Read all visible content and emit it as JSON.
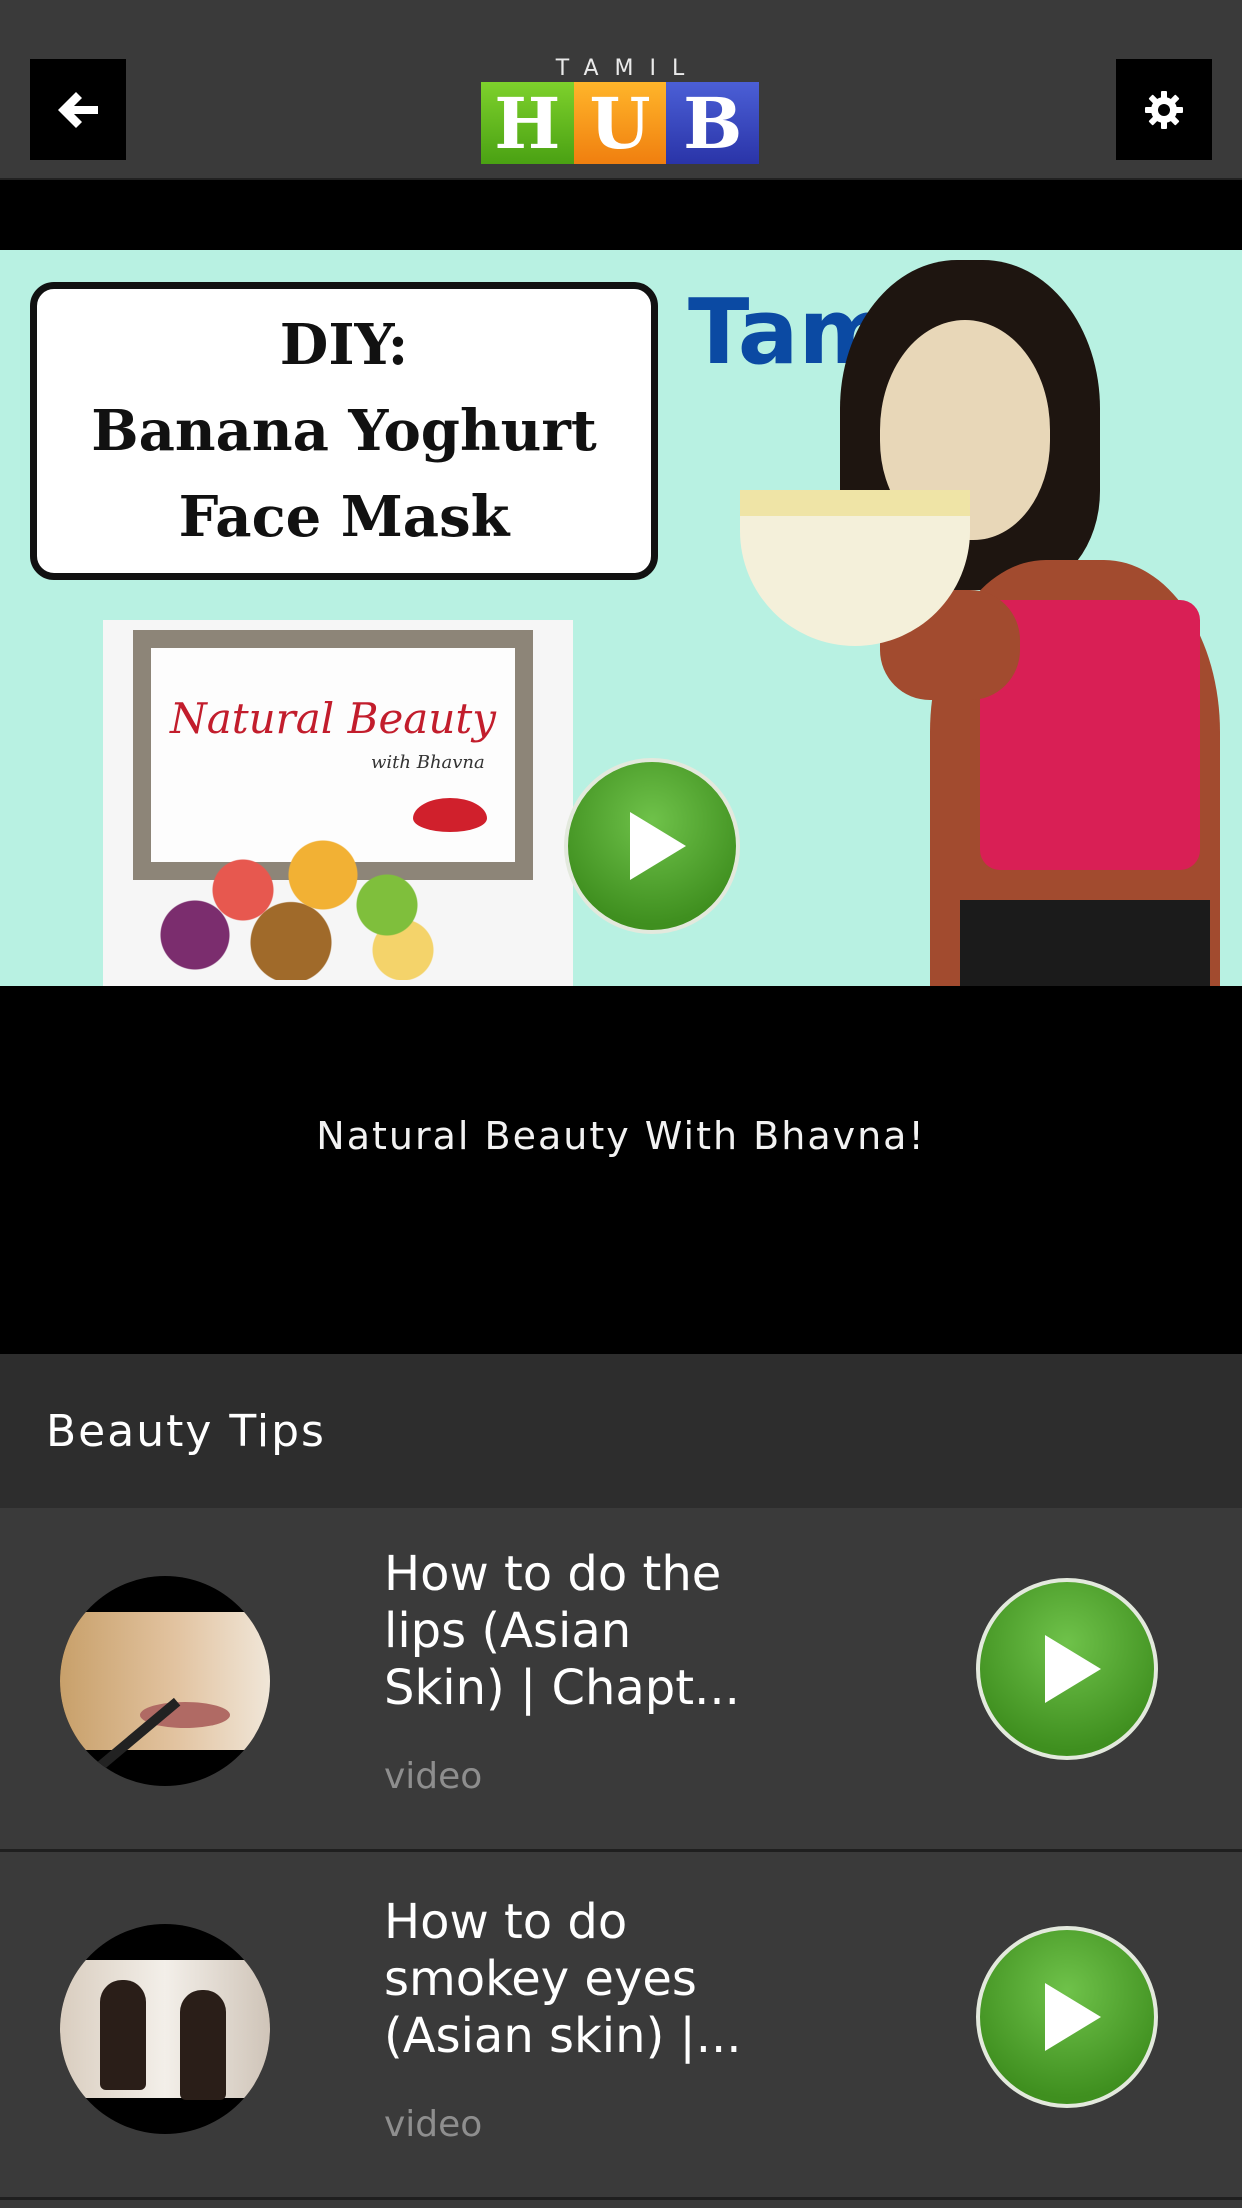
{
  "header": {
    "back_icon": "arrow-left-icon",
    "settings_icon": "gear-icon",
    "logo": {
      "top": "TAMIL",
      "letters": [
        "H",
        "U",
        "B"
      ]
    }
  },
  "hero": {
    "image": {
      "box_lines": [
        "DIY:",
        "Banana Yoghurt",
        "Face Mask"
      ],
      "tamil": "Tamil",
      "frame_title": "Natural Beauty",
      "frame_sub": "with Bhavna"
    },
    "play_icon": "play-icon",
    "caption": "Natural Beauty With Bhavna!"
  },
  "section": {
    "title": "Beauty Tips"
  },
  "items": [
    {
      "title": "How to do the lips (Asian Skin) | Chapt...",
      "type": "video",
      "play_icon": "play-icon"
    },
    {
      "title": "How to do smokey eyes (Asian skin) |...",
      "type": "video",
      "play_icon": "play-icon"
    }
  ],
  "colors": {
    "background": "#3a3a3a",
    "section_header": "#2d2d2d",
    "play_green": "#4c9f27",
    "logo_h": "#5fb81c",
    "logo_u": "#f7971c",
    "logo_b": "#3a47c0"
  }
}
